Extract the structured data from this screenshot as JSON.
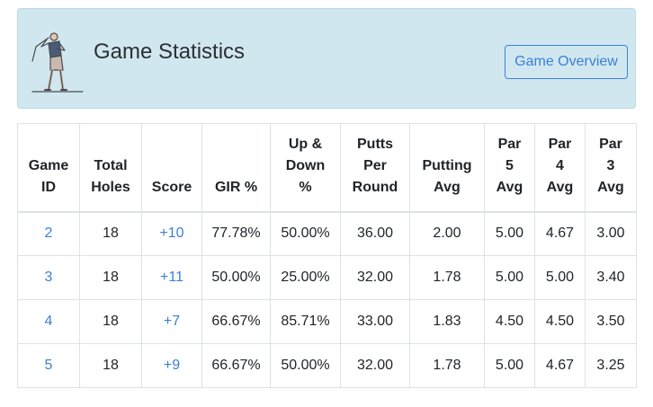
{
  "header": {
    "title": "Game Statistics",
    "overview_button": "Game Overview"
  },
  "colors": {
    "header_bg": "#d1e7ef",
    "link": "#3c7fd8",
    "border": "#dee2e6"
  },
  "table": {
    "columns": [
      [
        "Game",
        "ID"
      ],
      [
        "Total",
        "Holes"
      ],
      [
        "Score"
      ],
      [
        "GIR %"
      ],
      [
        "Up &",
        "Down",
        "%"
      ],
      [
        "Putts",
        "Per",
        "Round"
      ],
      [
        "Putting",
        "Avg"
      ],
      [
        "Par",
        "5",
        "Avg"
      ],
      [
        "Par",
        "4",
        "Avg"
      ],
      [
        "Par",
        "3",
        "Avg"
      ]
    ],
    "rows": [
      [
        "2",
        "18",
        "+10",
        "77.78%",
        "50.00%",
        "36.00",
        "2.00",
        "5.00",
        "4.67",
        "3.00"
      ],
      [
        "3",
        "18",
        "+11",
        "50.00%",
        "25.00%",
        "32.00",
        "1.78",
        "5.00",
        "5.00",
        "3.40"
      ],
      [
        "4",
        "18",
        "+7",
        "66.67%",
        "85.71%",
        "33.00",
        "1.83",
        "4.50",
        "4.50",
        "3.50"
      ],
      [
        "5",
        "18",
        "+9",
        "66.67%",
        "50.00%",
        "32.00",
        "1.78",
        "5.00",
        "4.67",
        "3.25"
      ]
    ]
  }
}
